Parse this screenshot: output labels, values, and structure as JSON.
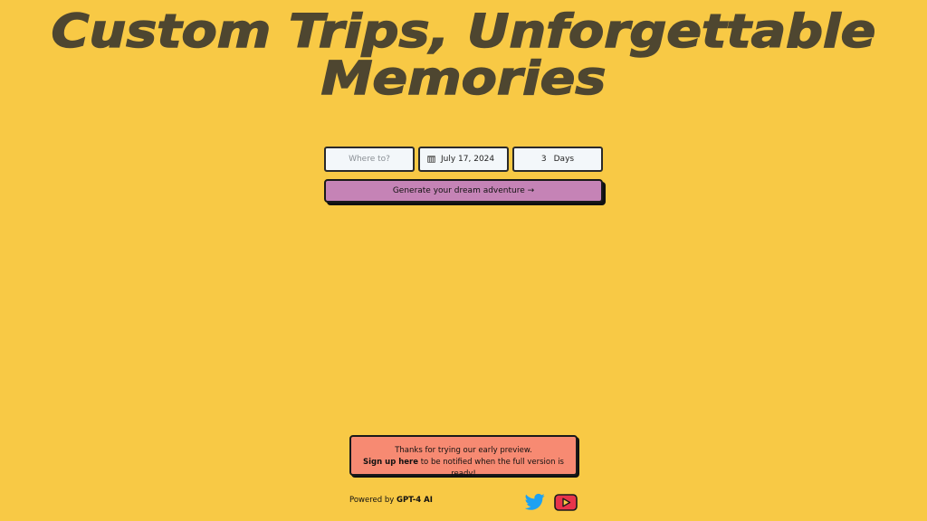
{
  "hero": {
    "title_line1": "Custom Trips, Unforgettable",
    "title_line2": "Memories"
  },
  "form": {
    "destination_placeholder": "Where to?",
    "destination_value": "",
    "date_value": "July 17, 2024",
    "days_value": "3",
    "days_unit": "Days",
    "calendar_icon": "calendar-icon"
  },
  "generate_button": {
    "label": "Generate your dream adventure →"
  },
  "notice": {
    "line1": "Thanks for trying our early preview.",
    "signup_link": "Sign up here",
    "line2_rest": " to be notified when the full version is ready!"
  },
  "footer": {
    "powered_prefix": "Powered by ",
    "powered_brand": "GPT-4 AI",
    "social_icons": [
      "twitter-icon",
      "youtube-icon"
    ]
  },
  "colors": {
    "background": "#F8C945",
    "title": "#4E4630",
    "button": "#C583B6",
    "notice": "#F78A72",
    "twitter": "#1DA1F2",
    "youtube": "#E8344A"
  }
}
